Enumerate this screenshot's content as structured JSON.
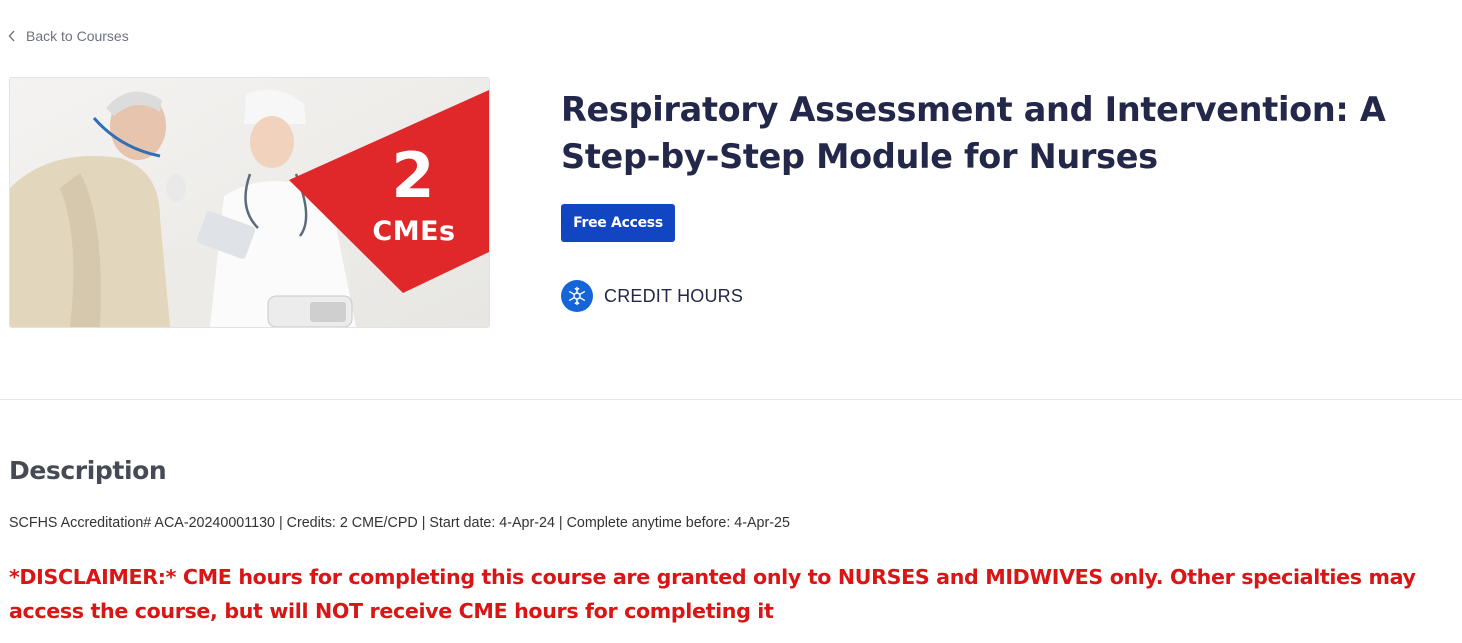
{
  "nav": {
    "back_label": "Back to Courses"
  },
  "course": {
    "image_badge": {
      "number": "2",
      "label": "CMEs",
      "color": "#e0282b"
    },
    "title": "Respiratory Assessment and Intervention: A Step-by-Step Module for Nurses",
    "access_label": "Free Access",
    "credit_label": "CREDIT HOURS"
  },
  "description": {
    "heading": "Description",
    "meta": "SCFHS Accreditation# ACA-20240001130 | Credits: 2 CME/CPD | Start date: 4-Apr-24 | Complete anytime before: 4-Apr-25",
    "disclaimer": "*DISCLAIMER:* CME hours for completing this course are granted only to NURSES and MIDWIVES only. Other specialties may access the course, but will NOT receive CME hours for completing it"
  },
  "colors": {
    "accent_blue": "#1145c2",
    "icon_blue": "#1565d8",
    "disclaimer_red": "#d91515",
    "title_navy": "#23274a"
  },
  "icons": {
    "back": "chevron-left-icon",
    "credit": "snowflake-badge-icon"
  }
}
